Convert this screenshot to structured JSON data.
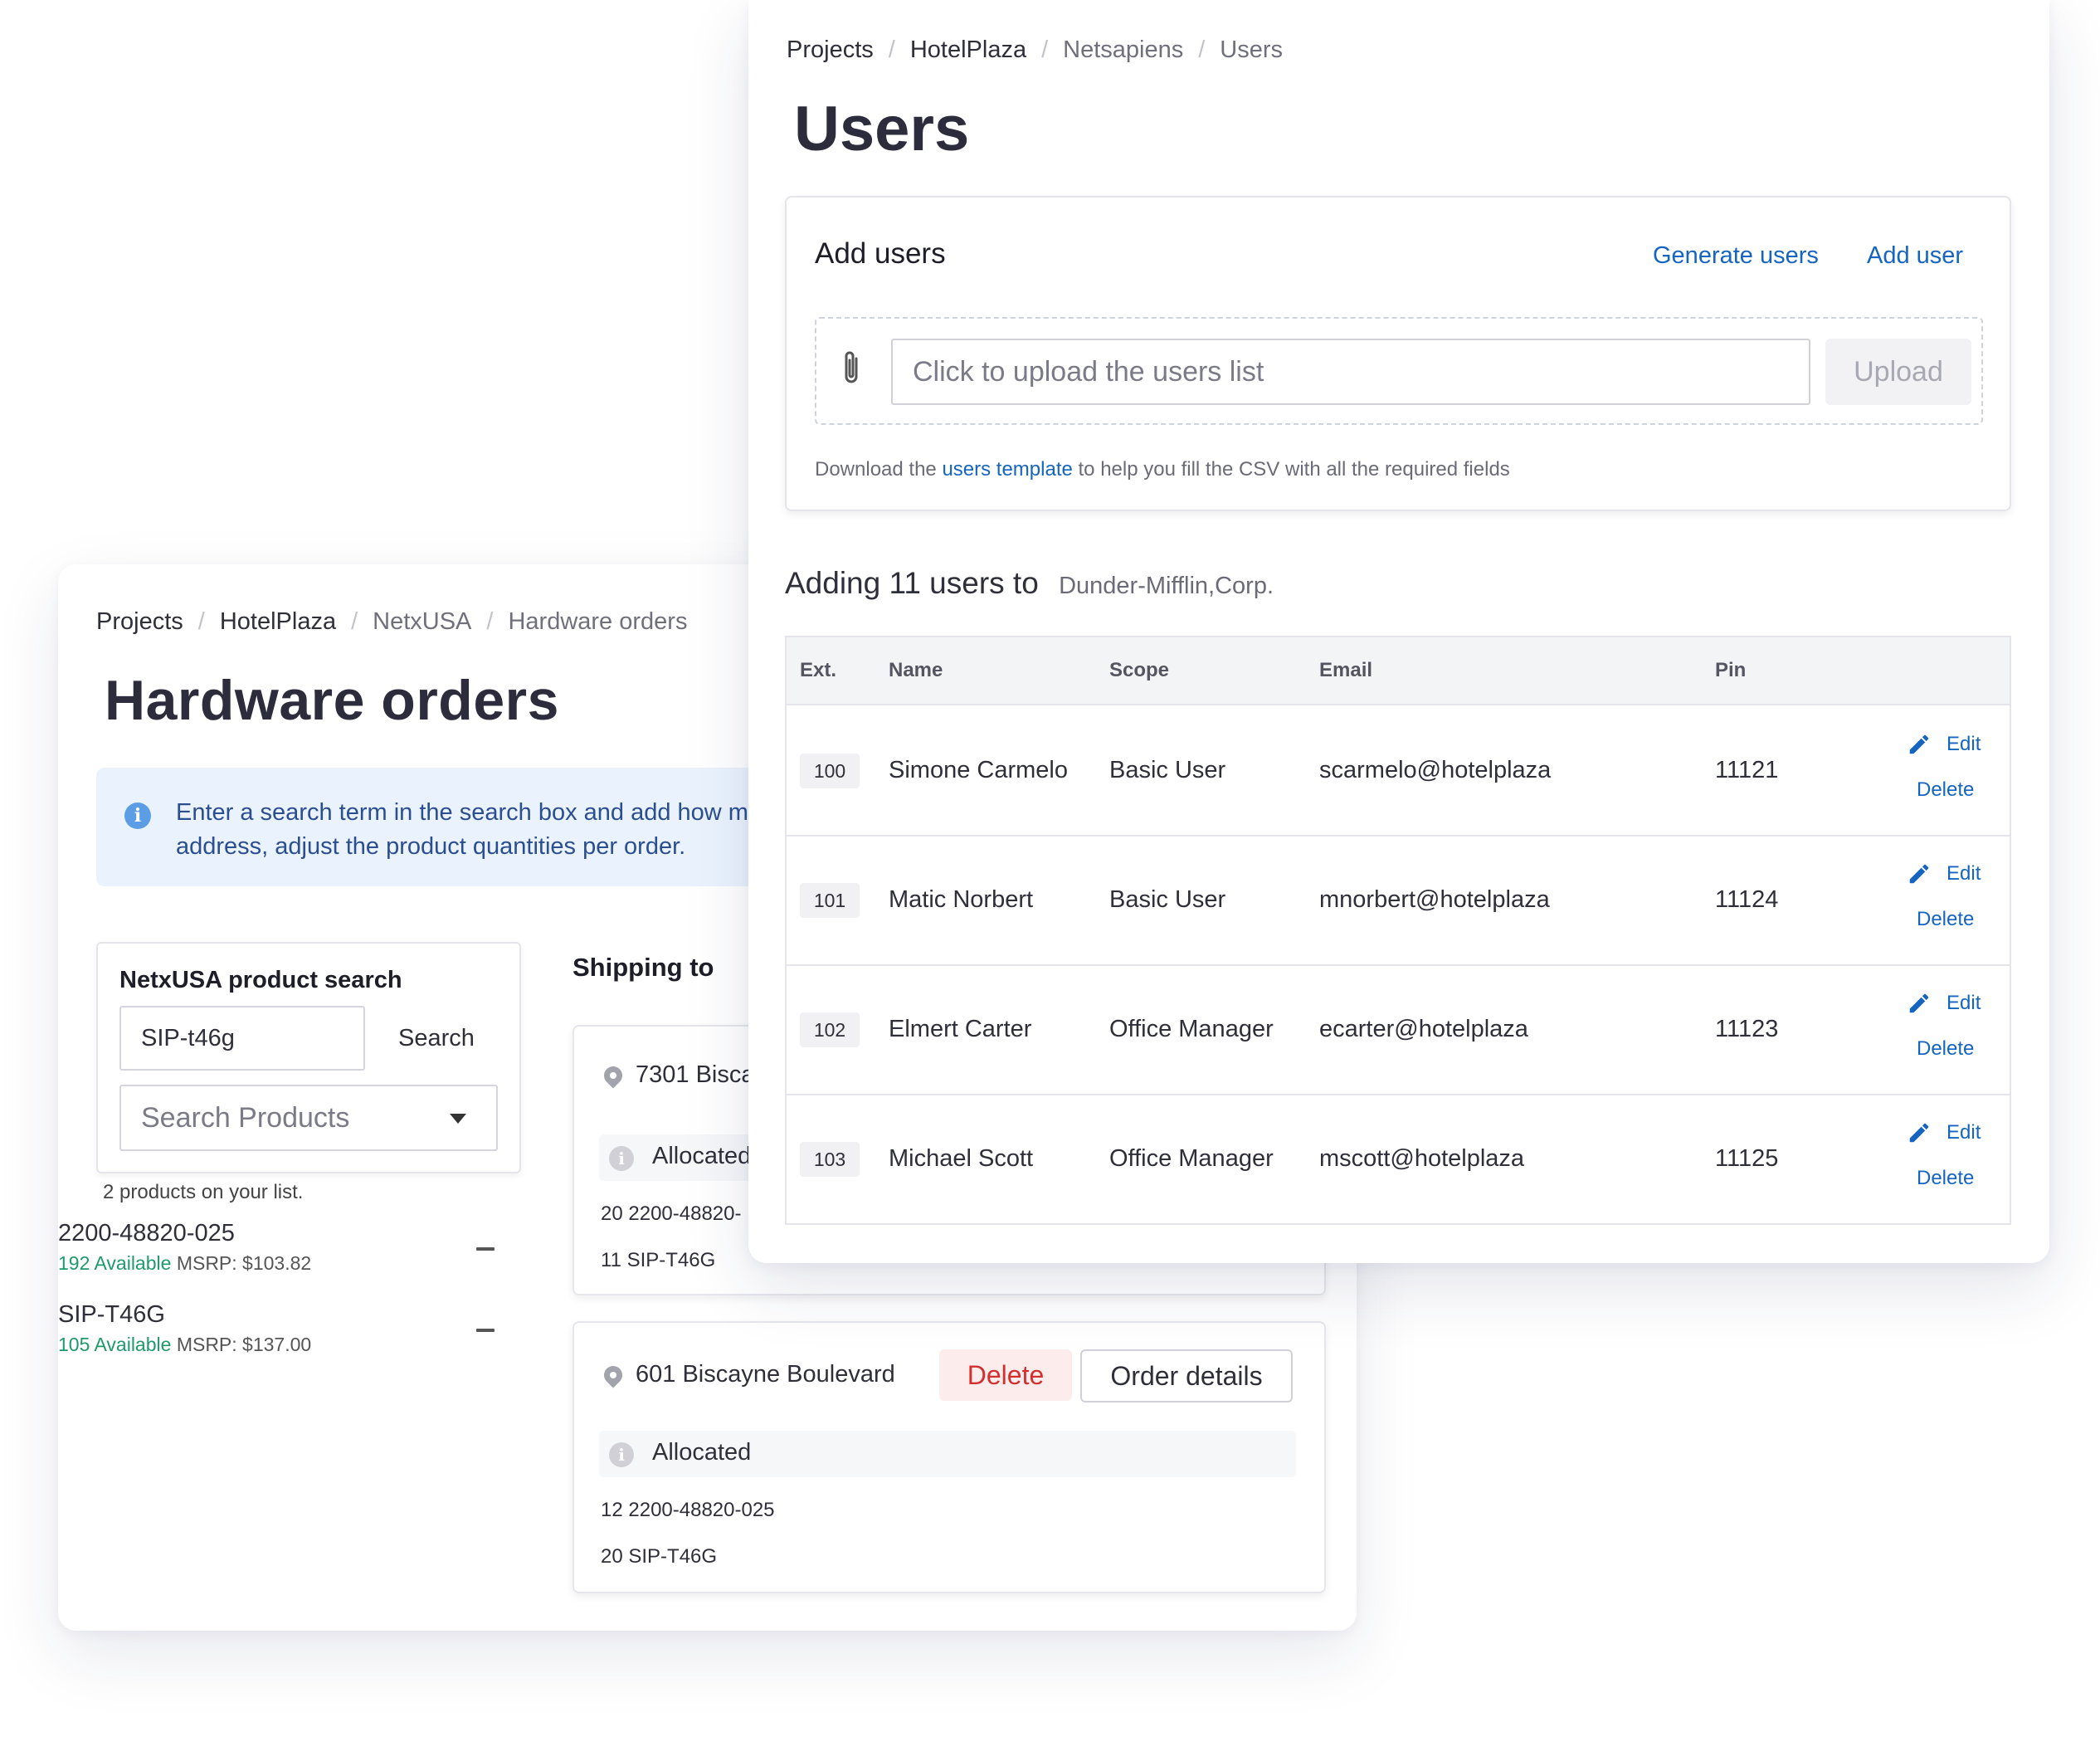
{
  "hardware": {
    "breadcrumb": [
      "Projects",
      "HotelPlaza",
      "NetxUSA",
      "Hardware orders"
    ],
    "title": "Hardware orders",
    "info_text_line1": "Enter a search term in the search box and add how m",
    "info_text_line2": "address, adjust the product quantities per order.",
    "search": {
      "title": "NetxUSA product search",
      "input_value": "SIP-t46g",
      "button": "Search",
      "select_placeholder": "Search Products"
    },
    "list_count": "2 products on your list.",
    "products": [
      {
        "name": "2200-48820-025",
        "available": "192 Available",
        "msrp": "MSRP: $103.82"
      },
      {
        "name": "SIP-T46G",
        "available": "105 Available",
        "msrp": "MSRP: $137.00"
      }
    ],
    "shipping_title": "Shipping to",
    "shipments": [
      {
        "address": "7301 Bisca",
        "status": "Allocated",
        "items": [
          {
            "qty": "20",
            "sku": "2200-48820-"
          },
          {
            "qty": "11",
            "sku": "SIP-T46G"
          }
        ]
      },
      {
        "address": "601 Biscayne Boulevard",
        "status": "Allocated",
        "delete": "Delete",
        "details": "Order details",
        "items": [
          {
            "qty": "12",
            "sku": "2200-48820-025"
          },
          {
            "qty": "20",
            "sku": "SIP-T46G"
          }
        ]
      }
    ]
  },
  "users": {
    "breadcrumb": [
      "Projects",
      "HotelPlaza",
      "Netsapiens",
      "Users"
    ],
    "title": "Users",
    "add_card": {
      "title": "Add users",
      "generate": "Generate users",
      "add": "Add user",
      "upload_placeholder": "Click to upload the users list",
      "upload_button": "Upload",
      "note_before": "Download the ",
      "note_link": "users template",
      "note_after": " to help you fill the CSV with all the required fields"
    },
    "adding_text": "Adding 11 users to",
    "adding_corp": "Dunder-Mifflin,Corp.",
    "columns": [
      "Ext.",
      "Name",
      "Scope",
      "Email",
      "Pin"
    ],
    "rows": [
      {
        "ext": "100",
        "name": "Simone Carmelo",
        "scope": "Basic User",
        "email": "scarmelo@hotelplaza",
        "pin": "11121",
        "edit": "Edit",
        "delete": "Delete"
      },
      {
        "ext": "101",
        "name": "Matic Norbert",
        "scope": "Basic User",
        "email": "mnorbert@hotelplaza",
        "pin": "11124",
        "edit": "Edit",
        "delete": "Delete"
      },
      {
        "ext": "102",
        "name": "Elmert Carter",
        "scope": "Office Manager",
        "email": "ecarter@hotelplaza",
        "pin": "11123",
        "edit": "Edit",
        "delete": "Delete"
      },
      {
        "ext": "103",
        "name": "Michael Scott",
        "scope": "Office Manager",
        "email": "mscott@hotelplaza",
        "pin": "11125",
        "edit": "Edit",
        "delete": "Delete"
      }
    ]
  },
  "colors": {
    "link": "#1565c0",
    "available": "#1f9a6a",
    "danger": "#d32f2f",
    "info_bg": "#eaf3fd"
  },
  "icons": [
    "info-icon",
    "chevron-down-icon",
    "minus-icon",
    "map-pin-icon",
    "paperclip-icon",
    "pencil-icon"
  ]
}
